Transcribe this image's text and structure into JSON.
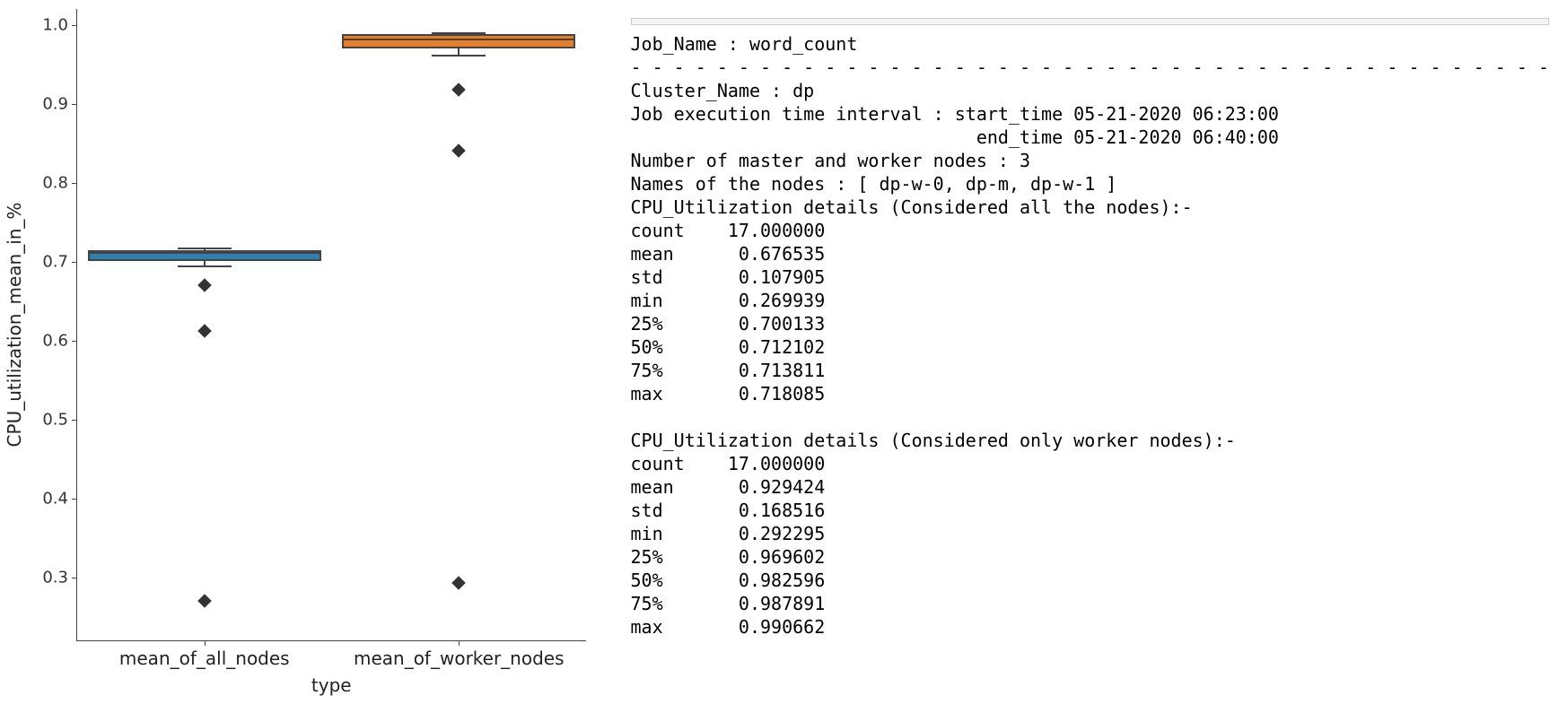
{
  "chart_data": {
    "type": "boxplot",
    "xlabel": "type",
    "ylabel": "CPU_utilization_mean_in_%",
    "ylim": [
      0.22,
      1.02
    ],
    "yticks": [
      0.3,
      0.4,
      0.5,
      0.6,
      0.7,
      0.8,
      0.9,
      1.0
    ],
    "categories": [
      "mean_of_all_nodes",
      "mean_of_worker_nodes"
    ],
    "series": [
      {
        "name": "mean_of_all_nodes",
        "color": "#2f7fb1",
        "q1": 0.700133,
        "median": 0.712102,
        "q3": 0.713811,
        "whisker_low": 0.695,
        "whisker_high": 0.718085,
        "outliers": [
          0.67,
          0.612,
          0.27
        ]
      },
      {
        "name": "mean_of_worker_nodes",
        "color": "#e57e26",
        "q1": 0.969602,
        "median": 0.982596,
        "q3": 0.987891,
        "whisker_low": 0.962,
        "whisker_high": 0.990662,
        "outliers": [
          0.918,
          0.84,
          0.292295
        ]
      }
    ]
  },
  "report": {
    "job_name_line": "Job_Name : word_count",
    "divider": "- - - - - - - - - - - - - - - - - - - - - - - - - - - - - - - - - - - - - - - - - - -",
    "cluster_name_line": "Cluster_Name : dp",
    "interval_line1": "Job execution time interval : start_time 05-21-2020 06:23:00",
    "interval_line2": "                                end_time 05-21-2020 06:40:00",
    "nodes_count_line": "Number of master and worker nodes : 3",
    "nodes_names_line": "Names of the nodes : [ dp-w-0, dp-m, dp-w-1 ]",
    "section_all_header": "CPU_Utilization details (Considered all the nodes):-",
    "all_stats": {
      "count": "count    17.000000",
      "mean": "mean      0.676535",
      "std": "std       0.107905",
      "min": "min       0.269939",
      "p25": "25%       0.700133",
      "p50": "50%       0.712102",
      "p75": "75%       0.713811",
      "max": "max       0.718085"
    },
    "section_worker_header": "CPU_Utilization details (Considered only worker nodes):-",
    "worker_stats": {
      "count": "count    17.000000",
      "mean": "mean      0.929424",
      "std": "std       0.168516",
      "min": "min       0.292295",
      "p25": "25%       0.969602",
      "p50": "50%       0.982596",
      "p75": "75%       0.987891",
      "max": "max       0.990662"
    }
  }
}
